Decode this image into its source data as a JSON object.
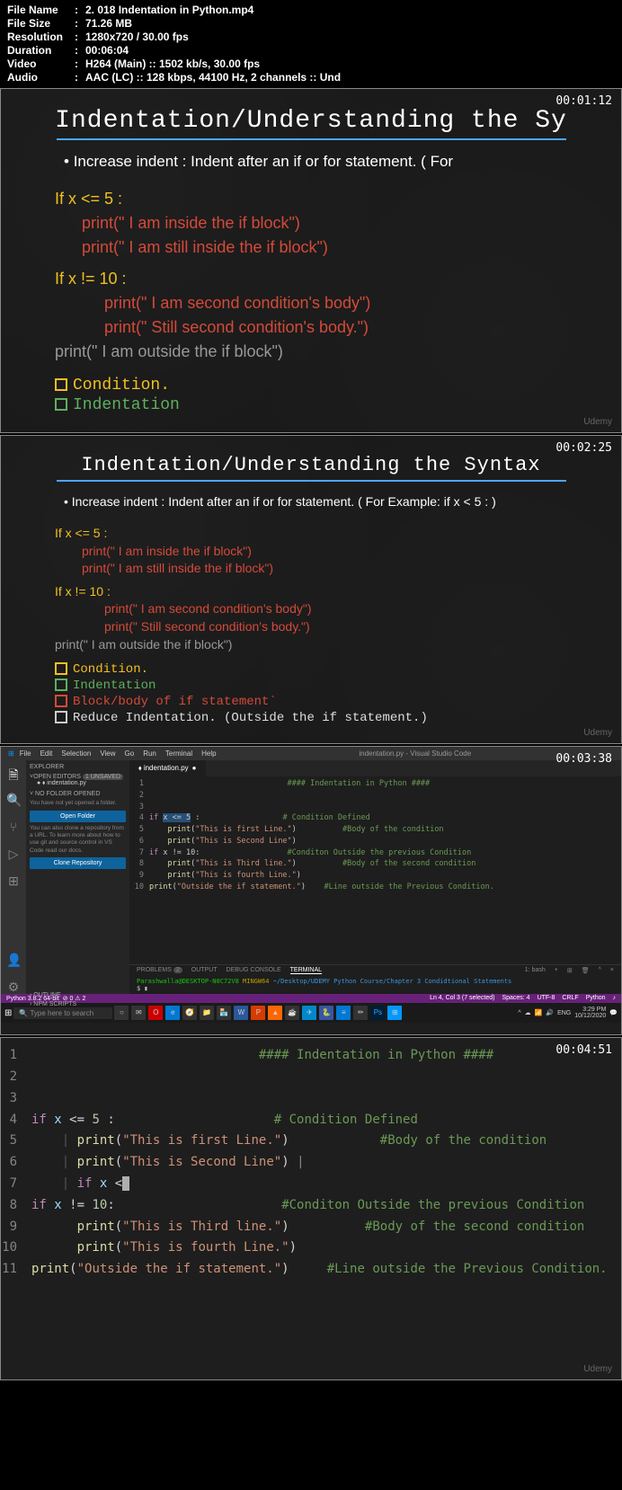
{
  "metadata": {
    "fileName": "2. 018 Indentation in Python.mp4",
    "fileSize": "71.26 MB",
    "resolution": "1280x720 / 30.00 fps",
    "duration": "00:06:04",
    "video": "H264 (Main) :: 1502 kb/s, 30.00 fps",
    "audio": "AAC (LC) :: 128 kbps, 44100 Hz, 2 channels :: Und"
  },
  "labels": {
    "fileName": "File Name",
    "fileSize": "File Size",
    "resolution": "Resolution",
    "duration": "Duration",
    "video": "Video",
    "audio": "Audio"
  },
  "panel1": {
    "timestamp": "00:01:12",
    "title": "Indentation/Understanding the Sy",
    "bullet": "Increase indent : Indent after an if or for statement. ( For",
    "line1": "If x <= 5 :",
    "line2": "print(\" I am inside the if block\")",
    "line3": "print(\" I am still inside the if block\")",
    "line4": "If x != 10 :",
    "line5": "print(\" I am second condition's body\")",
    "line6": "print(\" Still second condition's body.\")",
    "line7": "print(\" I am outside the if block\")",
    "legend1": "Condition.",
    "legend2": "Indentation"
  },
  "panel2": {
    "timestamp": "00:02:25",
    "title": "Indentation/Understanding the Syntax",
    "bullet": "Increase indent : Indent after an if or for statement. ( For Example: if x < 5 : )",
    "line1": "If x <= 5 :",
    "line2": "print(\" I am inside the if block\")",
    "line3": "print(\" I am still inside the if block\")",
    "line4": "If x != 10 :",
    "line5": "print(\" I am second condition's body\")",
    "line6": "print(\" Still second condition's body.\")",
    "line7": "print(\" I am outside the if block\")",
    "legend1": "Condition.",
    "legend2": "Indentation",
    "legend3": "Block/body of if statement`",
    "legend4": "Reduce Indentation. (Outside the if statement.)"
  },
  "panel3": {
    "timestamp": "00:03:38",
    "vscode": {
      "title": "indentation.py - Visual Studio Code",
      "menu": [
        "File",
        "Edit",
        "Selection",
        "View",
        "Go",
        "Run",
        "Terminal",
        "Help"
      ],
      "sidebar": {
        "explorer": "EXPLORER",
        "openEditors": "OPEN EDITORS",
        "unsaved": "1 UNSAVED",
        "tabFile": "indentation.py",
        "noFolder": "NO FOLDER OPENED",
        "noFolderText": "You have not yet opened a folder.",
        "openFolder": "Open Folder",
        "cloneText": "You can also clone a repository from a URL. To learn more about how to use git and source control in VS Code read our docs.",
        "cloneRepo": "Clone Repository",
        "outline": "OUTLINE",
        "npmScripts": "NPM SCRIPTS"
      },
      "code": {
        "l1": "#### Indentation in Python ####",
        "l4_if": "if",
        "l4_sel": "x <= 5",
        "l4_colon": " :",
        "l4_comment": "# Condition Defined",
        "l5_print": "print",
        "l5_str": "\"This is first Line.\"",
        "l5_comment": "#Body of the condition",
        "l6_str": "\"This is Second Line\"",
        "l7_if": "if",
        "l7_cond": " x != 10:",
        "l7_comment": "#Conditon Outside the previous Condition",
        "l8_str": "\"This is Third line.\"",
        "l8_comment": "#Body of the second condition",
        "l9_str": "\"This is fourth Line.\"",
        "l10_str": "\"Outside the if statement.\"",
        "l10_comment": "#Line outside the Previous Condition."
      },
      "terminal": {
        "tabs": [
          "PROBLEMS",
          "OUTPUT",
          "DEBUG CONSOLE",
          "TERMINAL"
        ],
        "badge": "2",
        "shell": "1: bash",
        "prompt": "Parashwalla@DESKTOP-N0C72V8",
        "mingw": "MINGW64",
        "path": "~/Desktop/UDEMY Python Course/Chapter 3 Condidtional Statements",
        "dollar": "$"
      },
      "status": {
        "left": "Python 3.8.2 64-bit",
        "warn": "⊘ 0 ⚠ 2",
        "right": [
          "Ln 4, Col 3 (7 selected)",
          "Spaces: 4",
          "UTF-8",
          "CRLF",
          "Python",
          "♪"
        ]
      },
      "taskbar": {
        "search": "Type here to search",
        "time": "3:29 PM",
        "date": "10/12/2020"
      }
    }
  },
  "panel4": {
    "timestamp": "00:04:51",
    "lines": {
      "l1_comment": "#### Indentation in Python ####",
      "l4_if": "if",
      "l4_var": " x ",
      "l4_op": "<= ",
      "l4_num": "5",
      "l4_end": " :",
      "l4_comment": "# Condition Defined",
      "l5_print": "print",
      "l5_str": "\"This is first Line.\"",
      "l5_comment": "#Body of the condition",
      "l6_str": "\"This is Second Line\"",
      "l7_if": "if",
      "l7_var": " x ",
      "l7_op": "<",
      "l8_if": "if",
      "l8_var": " x ",
      "l8_op": "!= ",
      "l8_num": "10",
      "l8_end": ":",
      "l8_comment": "#Conditon Outside the previous Condition",
      "l9_str": "\"This is Third line.\"",
      "l9_comment": "#Body of the second condition",
      "l10_str": "\"This is fourth Line.\"",
      "l11_str": "\"Outside the if statement.\"",
      "l11_comment": "#Line outside the Previous Condition."
    }
  }
}
